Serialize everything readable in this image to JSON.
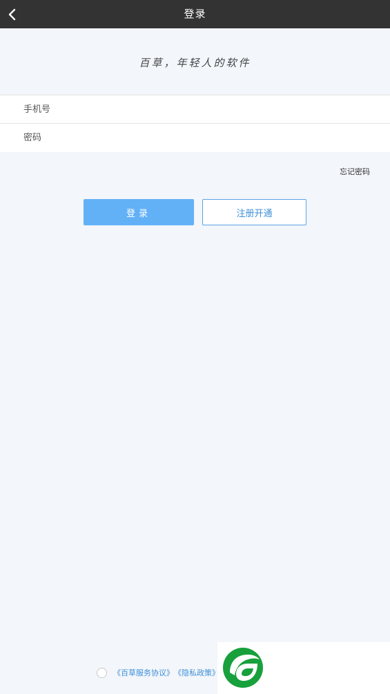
{
  "header": {
    "back_icon": "chevron-left-icon",
    "title": "登录"
  },
  "slogan": "百草，年轻人的软件",
  "form": {
    "phone_placeholder": "手机号",
    "password_placeholder": "密码"
  },
  "forgot_label": "忘记密码",
  "buttons": {
    "login": "登录",
    "register": "注册开通"
  },
  "agreement": {
    "service_link": "《百草服务协议》",
    "privacy_link": "《隐私政策》"
  },
  "logo": {
    "icon": "leaf-logo-icon"
  },
  "colors": {
    "header_bg": "#333333",
    "page_bg": "#f3f6fa",
    "primary_button": "#62b1f7",
    "link_blue": "#3d8fd9",
    "logo_green": "#17a03c"
  }
}
